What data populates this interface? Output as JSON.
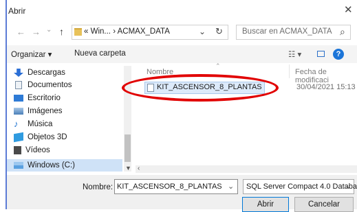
{
  "window": {
    "title": "Abrir",
    "close_glyph": "✕"
  },
  "nav": {
    "back": "←",
    "forward": "→",
    "up": "↑",
    "recent": "⌄",
    "breadcrumb_prefix": "«",
    "crumbs": [
      "Win...",
      "ACMAX_DATA"
    ],
    "crumb_sep": "›",
    "dropdown": "⌄",
    "refresh": "↻"
  },
  "search": {
    "placeholder": "Buscar en ACMAX_DATA",
    "icon": "⌕"
  },
  "toolbar": {
    "organize": "Organizar ▾",
    "new_folder": "Nueva carpeta",
    "view_icon": "☷ ▾",
    "help": "?"
  },
  "sidebar": {
    "items": [
      {
        "label": "Descargas",
        "icon": "download-icon",
        "color": "#2b6fd6"
      },
      {
        "label": "Documentos",
        "icon": "documents-icon",
        "color": "#7a8fa6"
      },
      {
        "label": "Escritorio",
        "icon": "desktop-icon",
        "color": "#2e7bd6"
      },
      {
        "label": "Imágenes",
        "icon": "pictures-icon",
        "color": "#4a7fb8"
      },
      {
        "label": "Música",
        "icon": "music-icon",
        "color": "#1f73d0"
      },
      {
        "label": "Objetos 3D",
        "icon": "objects3d-icon",
        "color": "#2f9be0"
      },
      {
        "label": "Vídeos",
        "icon": "videos-icon",
        "color": "#4a4a4a"
      },
      {
        "label": "Windows  (C:)",
        "icon": "drive-icon",
        "color": "#5aa0e0"
      }
    ]
  },
  "columns": {
    "name": "Nombre",
    "date": "Fecha de modificaci"
  },
  "files": [
    {
      "name": "KIT_ASCENSOR_8_PLANTAS",
      "date": "30/04/2021 15:13"
    }
  ],
  "footer": {
    "name_label": "Nombre:",
    "name_value": "KIT_ASCENSOR_8_PLANTAS",
    "type_value": "SQL Server Compact 4.0 Databa",
    "dropdown": "⌄",
    "open": "Abrir",
    "cancel": "Cancelar"
  },
  "colors": {
    "accent": "#0078d7",
    "highlight": "#e10000"
  }
}
